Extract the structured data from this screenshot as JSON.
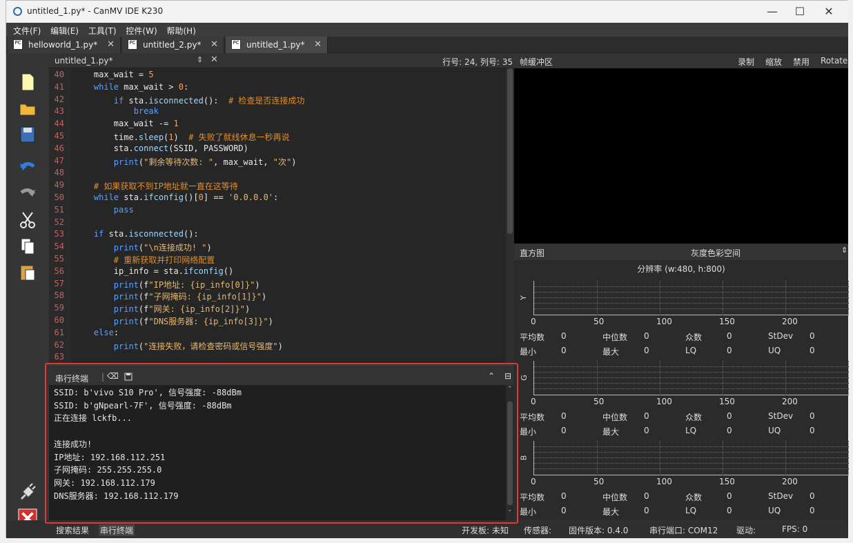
{
  "window": {
    "title": "untitled_1.py* - CanMV IDE K230"
  },
  "menu": [
    "文件(F)",
    "编辑(E)",
    "工具(T)",
    "控件(W)",
    "帮助(H)"
  ],
  "tabs": [
    {
      "label": "helloworld_1.py*"
    },
    {
      "label": "untitled_2.py*"
    },
    {
      "label": "untitled_1.py*"
    }
  ],
  "editor": {
    "filename": "untitled_1.py*",
    "position": "行号: 24, 列号: 35",
    "lines": [
      {
        "n": "40",
        "text": "    max_wait = 5"
      },
      {
        "n": "41",
        "text": "    while max_wait > 0:"
      },
      {
        "n": "42",
        "text": "        if sta.isconnected():  # 检查是否连接成功"
      },
      {
        "n": "43",
        "text": "            break"
      },
      {
        "n": "44",
        "text": "        max_wait -= 1"
      },
      {
        "n": "45",
        "text": "        time.sleep(1)  # 失败了就线休息一秒再说"
      },
      {
        "n": "46",
        "text": "        sta.connect(SSID, PASSWORD)"
      },
      {
        "n": "47",
        "text": "        print(\"剩余等待次数: \", max_wait, \"次\")"
      },
      {
        "n": "48",
        "text": ""
      },
      {
        "n": "49",
        "text": "    # 如果获取不到IP地址就一直在这等待"
      },
      {
        "n": "50",
        "text": "    while sta.ifconfig()[0] == '0.0.0.0':"
      },
      {
        "n": "51",
        "text": "        pass"
      },
      {
        "n": "52",
        "text": ""
      },
      {
        "n": "53",
        "text": "    if sta.isconnected():"
      },
      {
        "n": "54",
        "text": "        print(\"\\n连接成功! \")"
      },
      {
        "n": "55",
        "text": "        # 重新获取并打印网络配置"
      },
      {
        "n": "56",
        "text": "        ip_info = sta.ifconfig()"
      },
      {
        "n": "57",
        "text": "        print(f\"IP地址: {ip_info[0]}\")"
      },
      {
        "n": "58",
        "text": "        print(f\"子网掩码: {ip_info[1]}\")"
      },
      {
        "n": "59",
        "text": "        print(f\"网关: {ip_info[2]}\")"
      },
      {
        "n": "60",
        "text": "        print(f\"DNS服务器: {ip_info[3]}\")"
      },
      {
        "n": "61",
        "text": "    else:"
      },
      {
        "n": "62",
        "text": "        print(\"连接失败，请检查密码或信号强度\")"
      },
      {
        "n": "63",
        "text": ""
      }
    ]
  },
  "framebuffer": {
    "title": "帧缓冲区",
    "actions": [
      "录制",
      "缩放",
      "禁用",
      "Rotate"
    ]
  },
  "histogram": {
    "title": "直方图",
    "colorspace": "灰度色彩空间",
    "resolution": "分辨率 (w:480, h:800)",
    "ticks": [
      "0",
      "50",
      "100",
      "150",
      "200"
    ],
    "channels": [
      {
        "label": "Y",
        "stats": {
          "平均数": "0",
          "中位数": "0",
          "众数": "0",
          "StDev": "0",
          "最小": "0",
          "最大": "0",
          "LQ": "0",
          "UQ": "0"
        }
      },
      {
        "label": "G",
        "stats": {
          "平均数": "0",
          "中位数": "0",
          "众数": "0",
          "StDev": "0",
          "最小": "0",
          "最大": "0",
          "LQ": "0",
          "UQ": "0"
        }
      },
      {
        "label": "B",
        "stats": {
          "平均数": "0",
          "中位数": "0",
          "众数": "0",
          "StDev": "0",
          "最小": "0",
          "最大": "0",
          "LQ": "0",
          "UQ": "0"
        }
      }
    ]
  },
  "serial": {
    "title": "串行终端",
    "lines": [
      "SSID: b'vivo S10 Pro', 信号强度: -88dBm",
      "SSID: b'gNpearl-7F', 信号强度: -88dBm",
      "正在连接 lckfb...",
      "",
      "连接成功!",
      "IP地址: 192.168.112.251",
      "子网掩码: 255.255.255.0",
      "网关: 192.168.112.179",
      "DNS服务器: 192.168.112.179"
    ]
  },
  "bottom_tabs": [
    "搜索结果",
    "串行终端"
  ],
  "status": {
    "board": "开发板: 未知",
    "sensor": "传感器:",
    "firmware": "固件版本: 0.4.0",
    "serial_port": "串行端口: COM12",
    "driver": "驱动:",
    "fps": "FPS:  0"
  }
}
